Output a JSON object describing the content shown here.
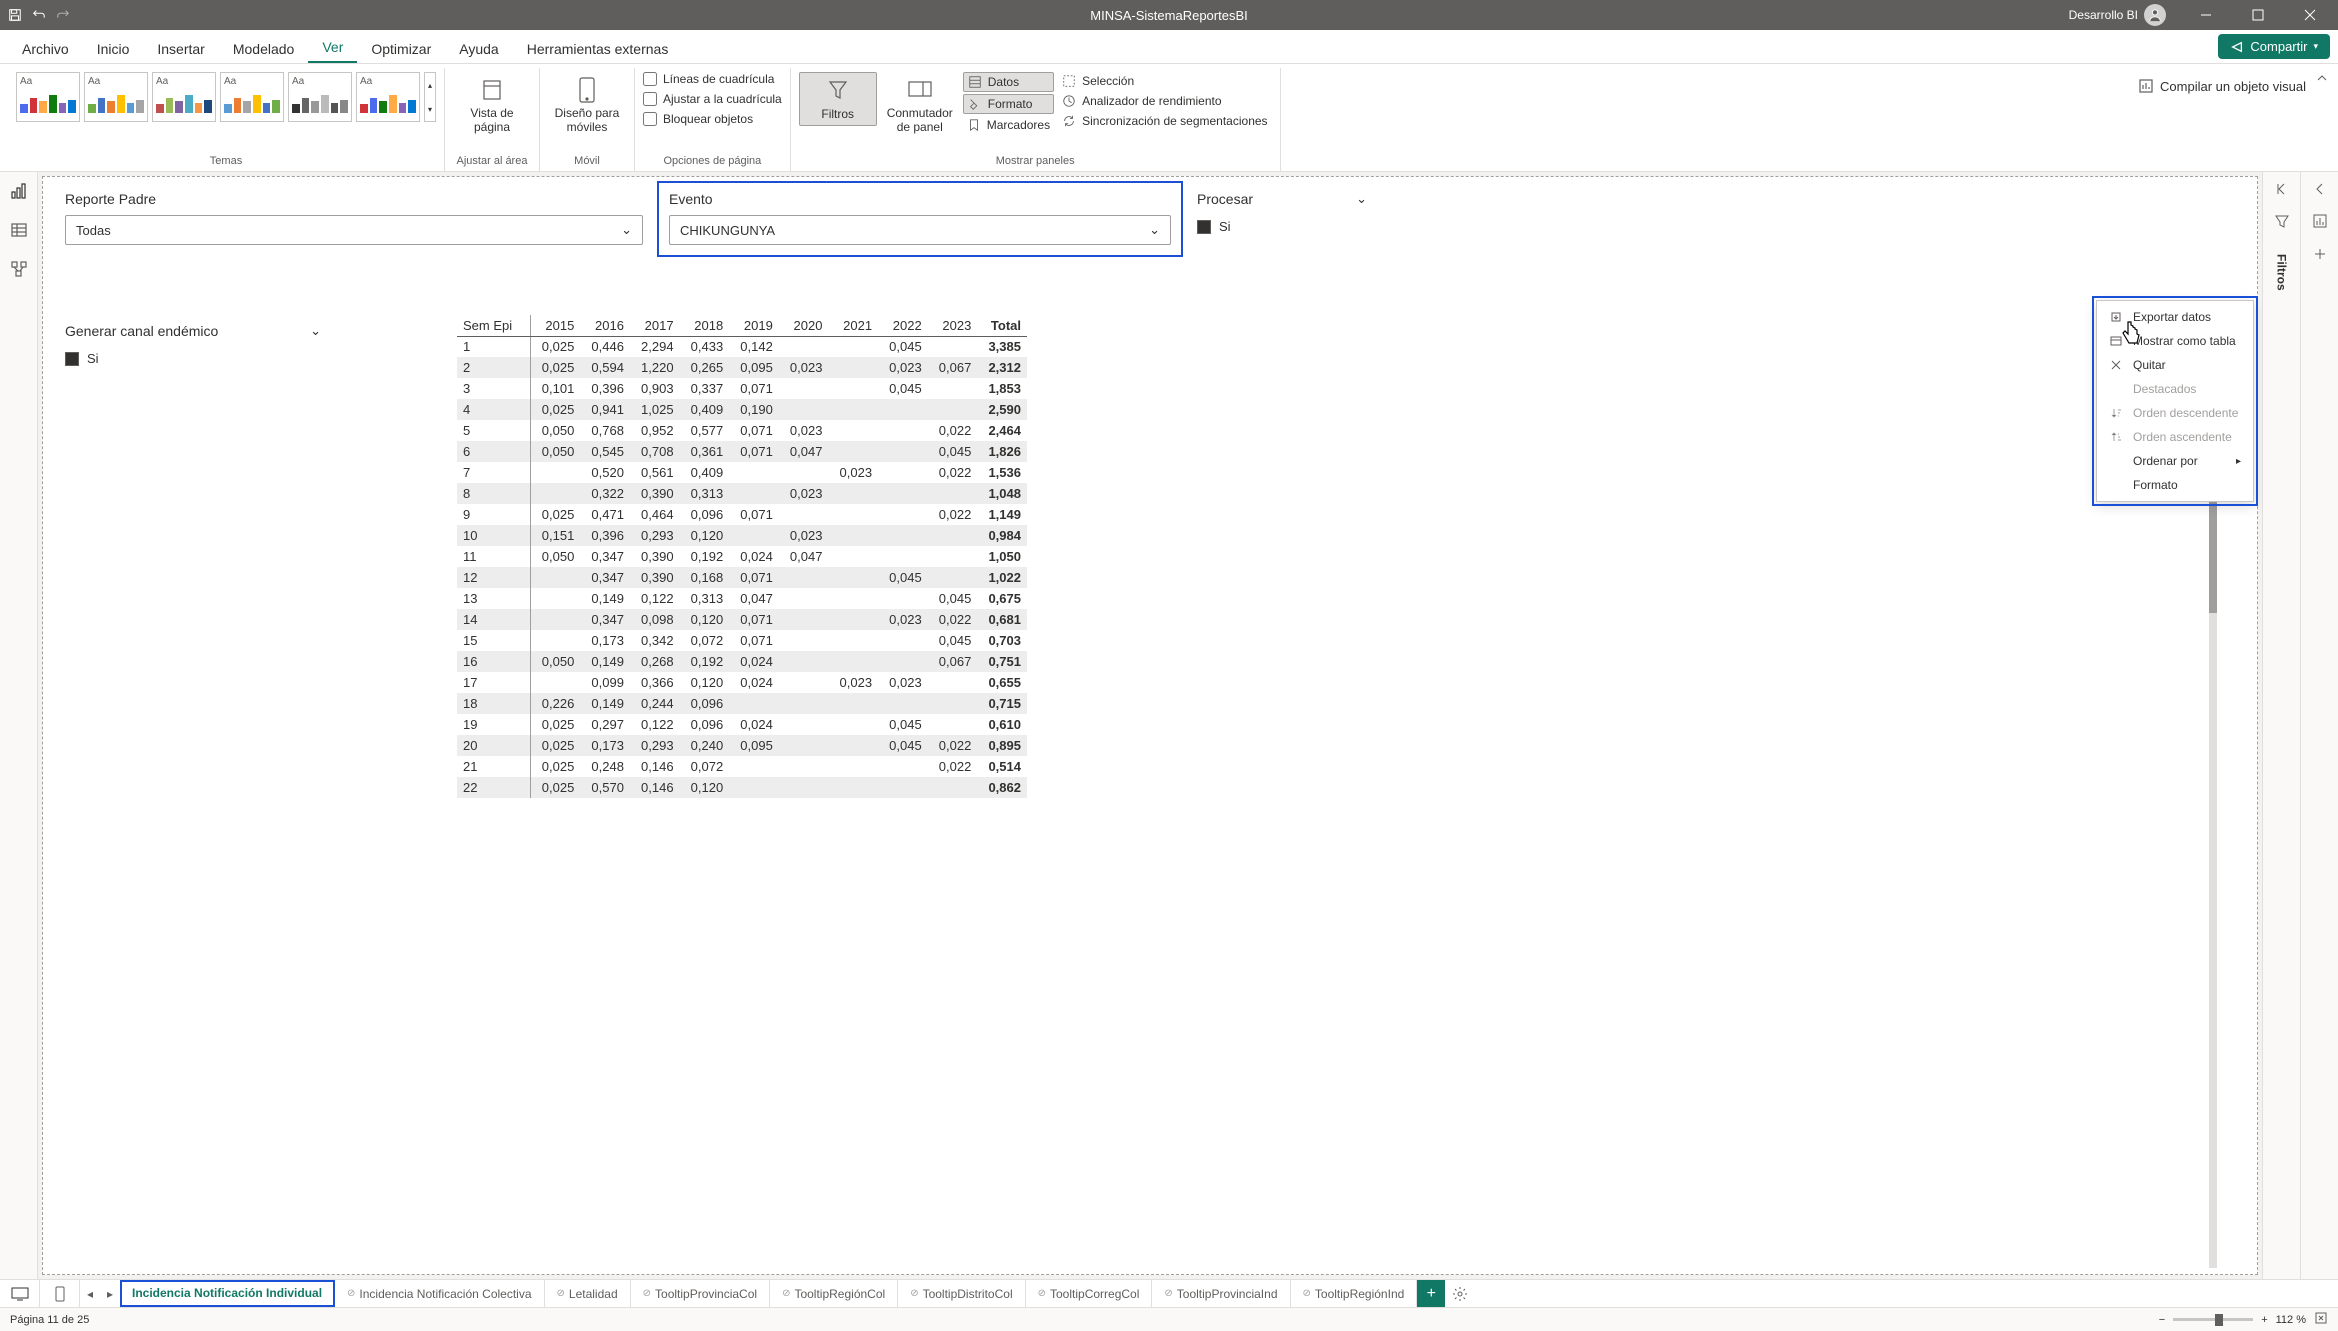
{
  "titlebar": {
    "title": "MINSA-SistemaReportesBI",
    "user": "Desarrollo BI"
  },
  "ribbon_tabs": {
    "archivo": "Archivo",
    "inicio": "Inicio",
    "insertar": "Insertar",
    "modelado": "Modelado",
    "ver": "Ver",
    "optimizar": "Optimizar",
    "ayuda": "Ayuda",
    "externas": "Herramientas externas",
    "compartir": "Compartir"
  },
  "ribbon": {
    "temas_label": "Temas",
    "ajustar_label": "Ajustar al área",
    "vista_pagina": "Vista de página",
    "movil_label": "Móvil",
    "diseno_moviles": "Diseño para móviles",
    "opciones_label": "Opciones de página",
    "lineas": "Líneas de cuadrícula",
    "ajustar_cuad": "Ajustar a la cuadrícula",
    "bloquear": "Bloquear objetos",
    "filtros": "Filtros",
    "conmutador": "Conmutador de panel",
    "panes_label": "Mostrar paneles",
    "datos": "Datos",
    "formato": "Formato",
    "marcadores": "Marcadores",
    "seleccion": "Selección",
    "analizador": "Analizador de rendimiento",
    "sincro": "Sincronización de segmentaciones",
    "compilar": "Compilar un objeto visual"
  },
  "filtros_pane": "Filtros",
  "slicers": {
    "reporte": {
      "title": "Reporte Padre",
      "value": "Todas"
    },
    "evento": {
      "title": "Evento",
      "value": "CHIKUNGUNYA"
    },
    "procesar": {
      "title": "Procesar",
      "value": "Si"
    },
    "canal": {
      "title": "Generar canal endémico",
      "value": "Si"
    }
  },
  "table": {
    "headers": [
      "Sem Epi",
      "2015",
      "2016",
      "2017",
      "2018",
      "2019",
      "2020",
      "2021",
      "2022",
      "2023",
      "Total"
    ],
    "rows": [
      [
        "1",
        "0,025",
        "0,446",
        "2,294",
        "0,433",
        "0,142",
        "",
        "",
        "0,045",
        "",
        "3,385"
      ],
      [
        "2",
        "0,025",
        "0,594",
        "1,220",
        "0,265",
        "0,095",
        "0,023",
        "",
        "0,023",
        "0,067",
        "2,312"
      ],
      [
        "3",
        "0,101",
        "0,396",
        "0,903",
        "0,337",
        "0,071",
        "",
        "",
        "0,045",
        "",
        "1,853"
      ],
      [
        "4",
        "0,025",
        "0,941",
        "1,025",
        "0,409",
        "0,190",
        "",
        "",
        "",
        "",
        "2,590"
      ],
      [
        "5",
        "0,050",
        "0,768",
        "0,952",
        "0,577",
        "0,071",
        "0,023",
        "",
        "",
        "0,022",
        "2,464"
      ],
      [
        "6",
        "0,050",
        "0,545",
        "0,708",
        "0,361",
        "0,071",
        "0,047",
        "",
        "",
        "0,045",
        "1,826"
      ],
      [
        "7",
        "",
        "0,520",
        "0,561",
        "0,409",
        "",
        "",
        "0,023",
        "",
        "0,022",
        "1,536"
      ],
      [
        "8",
        "",
        "0,322",
        "0,390",
        "0,313",
        "",
        "0,023",
        "",
        "",
        "",
        "1,048"
      ],
      [
        "9",
        "0,025",
        "0,471",
        "0,464",
        "0,096",
        "0,071",
        "",
        "",
        "",
        "0,022",
        "1,149"
      ],
      [
        "10",
        "0,151",
        "0,396",
        "0,293",
        "0,120",
        "",
        "0,023",
        "",
        "",
        "",
        "0,984"
      ],
      [
        "11",
        "0,050",
        "0,347",
        "0,390",
        "0,192",
        "0,024",
        "0,047",
        "",
        "",
        "",
        "1,050"
      ],
      [
        "12",
        "",
        "0,347",
        "0,390",
        "0,168",
        "0,071",
        "",
        "",
        "0,045",
        "",
        "1,022"
      ],
      [
        "13",
        "",
        "0,149",
        "0,122",
        "0,313",
        "0,047",
        "",
        "",
        "",
        "0,045",
        "0,675"
      ],
      [
        "14",
        "",
        "0,347",
        "0,098",
        "0,120",
        "0,071",
        "",
        "",
        "0,023",
        "0,022",
        "0,681"
      ],
      [
        "15",
        "",
        "0,173",
        "0,342",
        "0,072",
        "0,071",
        "",
        "",
        "",
        "0,045",
        "0,703"
      ],
      [
        "16",
        "0,050",
        "0,149",
        "0,268",
        "0,192",
        "0,024",
        "",
        "",
        "",
        "0,067",
        "0,751"
      ],
      [
        "17",
        "",
        "0,099",
        "0,366",
        "0,120",
        "0,024",
        "",
        "0,023",
        "0,023",
        "",
        "0,655"
      ],
      [
        "18",
        "0,226",
        "0,149",
        "0,244",
        "0,096",
        "",
        "",
        "",
        "",
        "",
        "0,715"
      ],
      [
        "19",
        "0,025",
        "0,297",
        "0,122",
        "0,096",
        "0,024",
        "",
        "",
        "0,045",
        "",
        "0,610"
      ],
      [
        "20",
        "0,025",
        "0,173",
        "0,293",
        "0,240",
        "0,095",
        "",
        "",
        "0,045",
        "0,022",
        "0,895"
      ],
      [
        "21",
        "0,025",
        "0,248",
        "0,146",
        "0,072",
        "",
        "",
        "",
        "",
        "0,022",
        "0,514"
      ],
      [
        "22",
        "0,025",
        "0,570",
        "0,146",
        "0,120",
        "",
        "",
        "",
        "",
        "",
        "0,862"
      ]
    ]
  },
  "context_menu": {
    "exportar": "Exportar datos",
    "mostrar": "Mostrar como tabla",
    "quitar": "Quitar",
    "destacados": "Destacados",
    "desc": "Orden descendente",
    "asc": "Orden ascendente",
    "ordenar": "Ordenar por",
    "formato": "Formato"
  },
  "page_tabs": {
    "p1": "Incidencia Notificación Individual",
    "p2": "Incidencia Notificación Colectiva",
    "p3": "Letalidad",
    "p4": "TooltipProvinciaCol",
    "p5": "TooltipRegiónCol",
    "p6": "TooltipDistritoCol",
    "p7": "TooltipCorregCol",
    "p8": "TooltipProvinciaInd",
    "p9": "TooltipRegiónInd"
  },
  "statusbar": {
    "page": "Página 11 de 25",
    "zoom": "112 %"
  }
}
